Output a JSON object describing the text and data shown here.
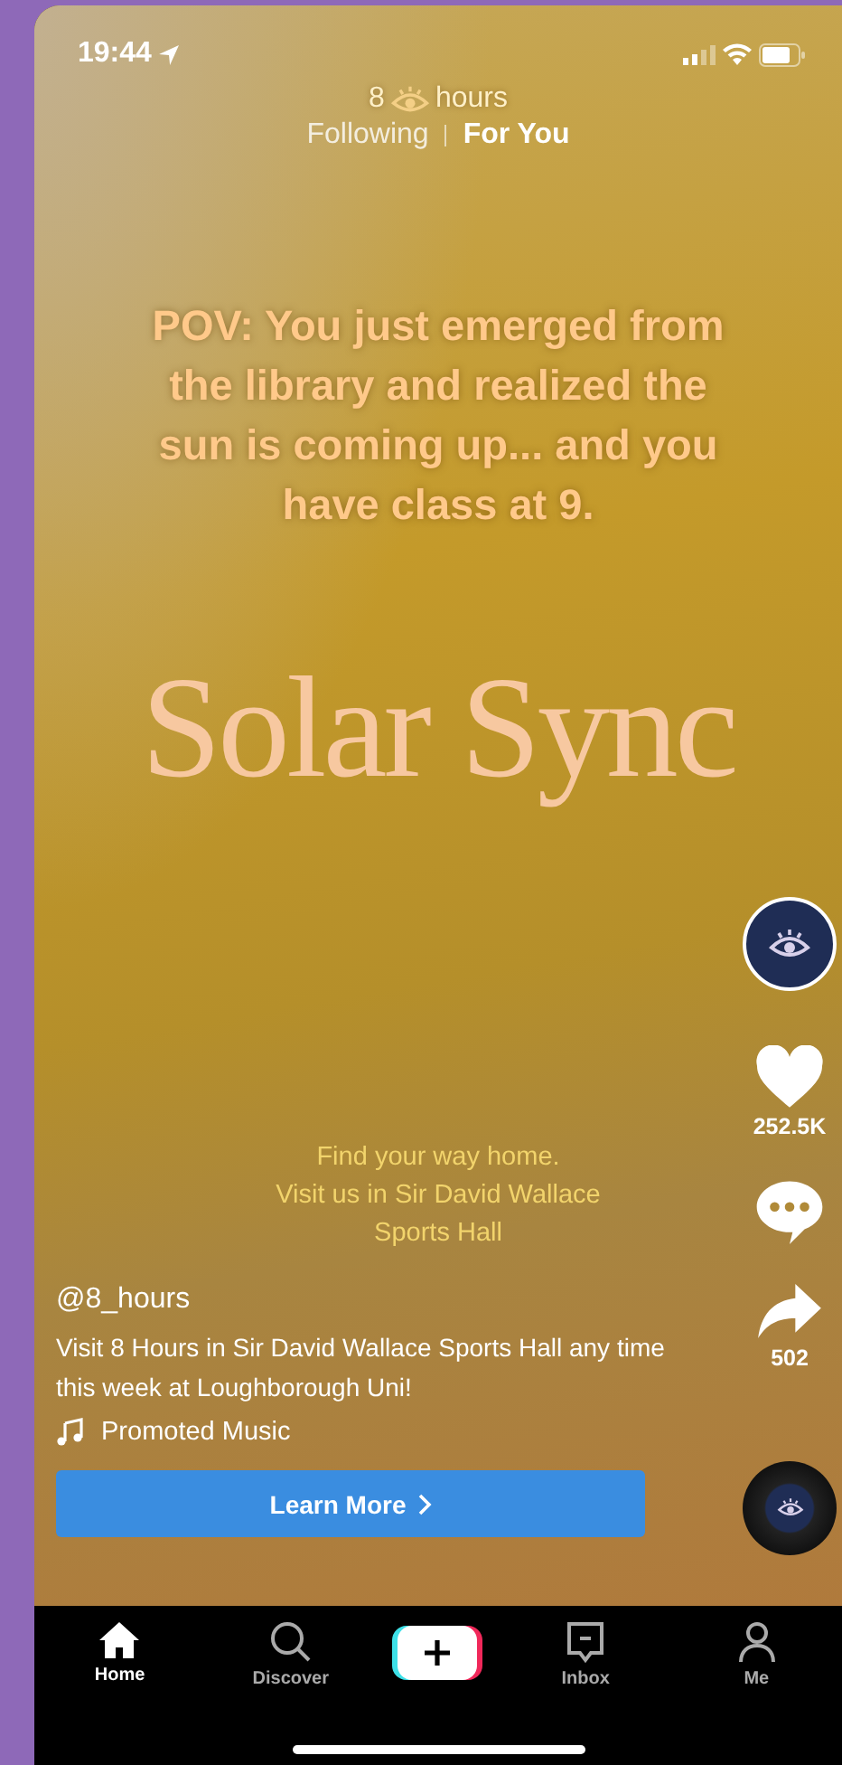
{
  "status_bar": {
    "time": "19:44"
  },
  "brand": {
    "number": "8",
    "word": "hours"
  },
  "feed_tabs": [
    {
      "label": "Following",
      "selected": false
    },
    {
      "label": "For You",
      "selected": true
    }
  ],
  "video": {
    "caption": "POV: You just emerged from the library and realized the sun is coming up... and you have class at 9.",
    "headline": "Solar Sync",
    "footer": "Find your way home.\nVisit us in Sir David Wallace\nSports Hall"
  },
  "actions": [
    {
      "kind": "like",
      "count": "252.5K"
    },
    {
      "kind": "comment"
    },
    {
      "kind": "share",
      "count": "502"
    }
  ],
  "post": {
    "username": "@8_hours",
    "description": "Visit 8 Hours in Sir David Wallace Sports Hall any time this week at Loughborough Uni!",
    "music": "Promoted Music",
    "cta": "Learn More"
  },
  "nav": [
    {
      "kind": "home",
      "label": "Home",
      "selected": true
    },
    {
      "kind": "discover",
      "label": "Discover",
      "selected": false
    },
    {
      "kind": "create"
    },
    {
      "kind": "inbox",
      "label": "Inbox",
      "selected": false
    },
    {
      "kind": "me",
      "label": "Me",
      "selected": false
    }
  ]
}
